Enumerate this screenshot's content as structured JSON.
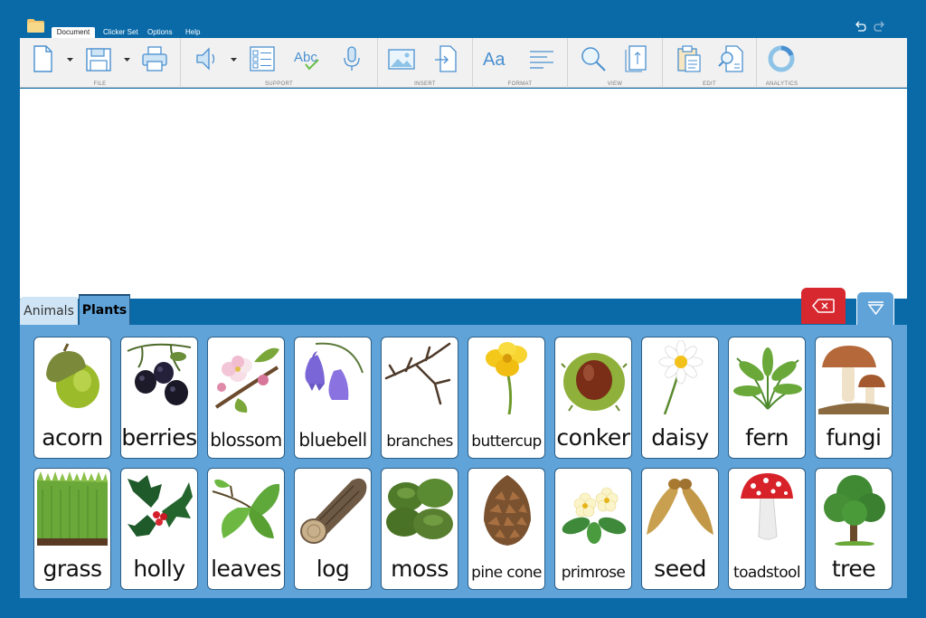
{
  "menu": {
    "tabs": [
      "Document",
      "Clicker Set",
      "Options",
      "Help"
    ]
  },
  "ribbon": {
    "groups": [
      "FILE",
      "SUPPORT",
      "INSERT",
      "FORMAT",
      "VIEW",
      "EDIT",
      "ANALYTICS"
    ],
    "icons": {
      "spell": "Abc",
      "font": "Aa"
    }
  },
  "set_tabs": [
    "Animals",
    "Plants"
  ],
  "active_set": "Plants",
  "cells": [
    "acorn",
    "berries",
    "blossom",
    "bluebell",
    "branches",
    "buttercup",
    "conker",
    "daisy",
    "fern",
    "fungi",
    "grass",
    "holly",
    "leaves",
    "log",
    "moss",
    "pine cone",
    "primrose",
    "seed",
    "toadstool",
    "tree"
  ],
  "colors": {
    "background": "#0a6aa8",
    "panel": "#5fa3d9",
    "delete": "#d7272f"
  }
}
